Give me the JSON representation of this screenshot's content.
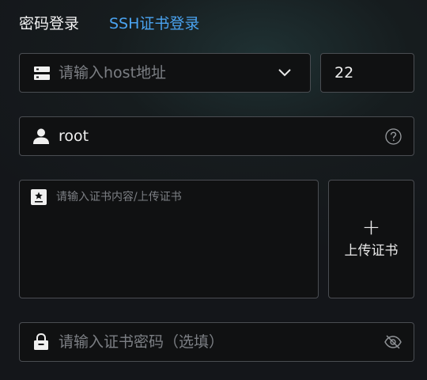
{
  "tabs": [
    {
      "label": "密码登录",
      "active": true
    },
    {
      "label": "SSH证书登录",
      "active": false
    }
  ],
  "colors": {
    "accent": "#4aa3f0",
    "text": "#f0f0f0",
    "placeholder": "#7c7f84",
    "border": "#4a4d52"
  },
  "host": {
    "placeholder": "请输入host地址",
    "icon": "server-icon",
    "dropdown_icon": "chevron-down-icon"
  },
  "port": {
    "value": "22"
  },
  "username": {
    "value": "root",
    "icon": "user-icon",
    "help_icon": "question-circle-icon"
  },
  "certificate": {
    "placeholder": "请输入证书内容/上传证书",
    "icon": "certificate-icon"
  },
  "upload": {
    "icon": "plus-icon",
    "label": "上传证书"
  },
  "cert_password": {
    "placeholder": "请输入证书密码（选填）",
    "icon": "lock-icon",
    "toggle_icon": "eye-off-icon"
  }
}
